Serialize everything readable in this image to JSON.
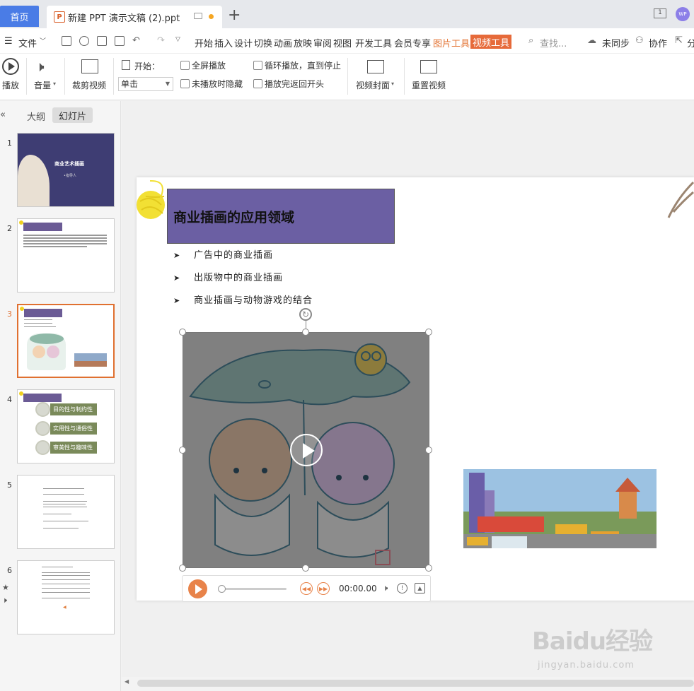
{
  "tabs": {
    "home": "首页",
    "document": "新建 PPT 演示文稿 (2).ppt"
  },
  "window": {
    "avatar": "WP",
    "page_badge": "1"
  },
  "menu": {
    "file": "文件",
    "items": [
      "开始",
      "插入",
      "设计",
      "切换",
      "动画",
      "放映",
      "审阅",
      "视图",
      "开发工具",
      "会员专享"
    ],
    "picture_tools": "图片工具",
    "video_tools": "视频工具",
    "search": "查找...",
    "sync": "未同步",
    "collab": "协作",
    "share": "分"
  },
  "ribbon": {
    "play": "播放",
    "volume": "音量",
    "trim": "裁剪视频",
    "start_label": "开始：",
    "start_value": "单击",
    "fullscreen": "全屏播放",
    "hide_when_not_playing": "未播放时隐藏",
    "loop": "循环播放，直到停止",
    "rewind": "播放完返回开头",
    "cover": "视频封面",
    "reset": "重置视频"
  },
  "left_panel": {
    "outline_tab": "大纲",
    "slides_tab": "幻灯片",
    "slide_numbers": [
      "1",
      "2",
      "3",
      "4",
      "5",
      "6"
    ],
    "thumb1_title": "商业艺术插画",
    "thumb1_subtitle": "•指导人",
    "thumb4_items": [
      "目的性与制约性",
      "实用性与通俗性",
      "审美性与趣味性"
    ]
  },
  "slide": {
    "title": "商业插画的应用领域",
    "bullets": [
      "广告中的商业插画",
      "出版物中的商业插画",
      "商业插画与动物游戏的结合"
    ]
  },
  "player": {
    "time": "00:00.00",
    "progress": 0
  },
  "watermark": {
    "main": "Baidu经验",
    "sub": "jingyan.baidu.com"
  },
  "colors": {
    "accent_blue": "#4a7ce6",
    "tool_orange": "#e66a3a",
    "title_purple": "#6b5fa3",
    "active_thumb_border": "#e07030"
  }
}
